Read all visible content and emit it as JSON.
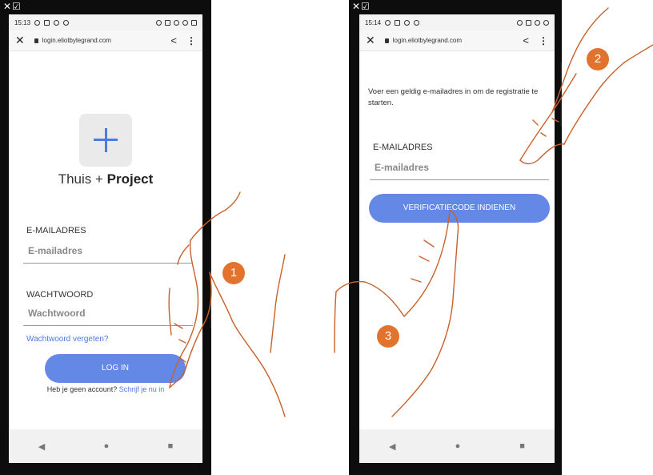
{
  "left_phone": {
    "header_icons": "✕☑",
    "status": {
      "time": "15:13"
    },
    "url": "login.eliotbylegrand.com",
    "brand": {
      "prefix": "Thuis + ",
      "bold": "Project"
    },
    "email": {
      "label": "E-MAILADRES",
      "placeholder": "E-mailadres"
    },
    "password": {
      "label": "WACHTWOORD",
      "placeholder": "Wachtwoord"
    },
    "forgot_link": "Wachtwoord vergeten?",
    "login_button": "LOG IN",
    "signup_prompt": "Heb je geen account?",
    "signup_link": "Schrijf je nu in",
    "step_marker": "1"
  },
  "right_phone": {
    "header_icons": "✕☑",
    "status": {
      "time": "15:14"
    },
    "url": "login.eliotbylegrand.com",
    "info_text": "Voer een geldig e-mailadres in om de registratie te starten.",
    "email": {
      "label": "E-MAILADRES",
      "placeholder": "E-mailadres"
    },
    "verify_button": "VERIFICATIECODE INDIENEN",
    "step_marker_2": "2",
    "step_marker_3": "3"
  },
  "nav": {
    "back": "◀",
    "home": "●",
    "recent": "■"
  },
  "colors": {
    "accent": "#6488e6",
    "marker": "#e2732c",
    "hand_stroke": "#c9602a"
  }
}
